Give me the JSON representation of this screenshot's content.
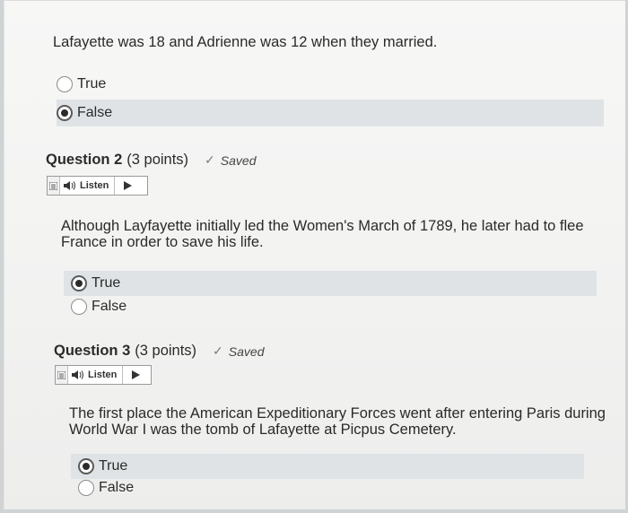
{
  "question1": {
    "text": "Lafayette was 18 and Adrienne was 12 when they married.",
    "options": [
      {
        "label": "True",
        "selected": false
      },
      {
        "label": "False",
        "selected": true
      }
    ]
  },
  "question2": {
    "title": "Question 2",
    "points": "(3 points)",
    "saved_label": "Saved",
    "listen_label": "Listen",
    "text_line1": "Although Layfayette initially led the Women's March of 1789, he later had to flee",
    "text_line2": "France in order to save his life.",
    "options": [
      {
        "label": "True",
        "selected": true
      },
      {
        "label": "False",
        "selected": false
      }
    ]
  },
  "question3": {
    "title": "Question 3",
    "points": "(3 points)",
    "saved_label": "Saved",
    "listen_label": "Listen",
    "text_line1": "The first place the American Expeditionary Forces went after entering Paris during",
    "text_line2": "World War I was the tomb of Lafayette at Picpus Cemetery.",
    "options": [
      {
        "label": "True",
        "selected": true
      },
      {
        "label": "False",
        "selected": false
      }
    ]
  },
  "colors": {
    "selected_row": "#dfe3e6",
    "text": "#2b2b2b",
    "check": "#7d7d7d"
  }
}
